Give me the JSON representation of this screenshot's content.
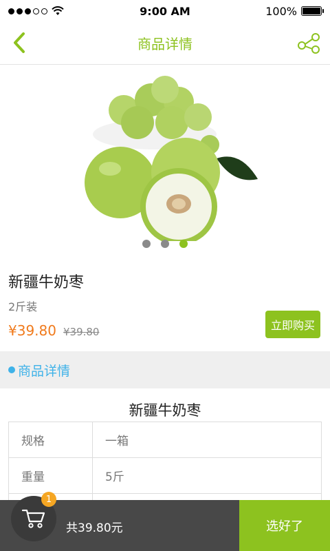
{
  "status_bar": {
    "time": "9:00 AM",
    "battery": "100%"
  },
  "nav": {
    "title": "商品详情",
    "back_icon": "chevron-left-icon",
    "share_icon": "share-icon"
  },
  "carousel": {
    "image": "green-jujube-fruit-image",
    "slide_count": 3,
    "active_index": 2
  },
  "product": {
    "name": "新疆牛奶枣",
    "spec": "2斤装",
    "price": "¥39.80",
    "original_price": "¥39.80",
    "buy_label": "立即购买"
  },
  "section": {
    "title": "商品详情"
  },
  "detail": {
    "title": "新疆牛奶枣",
    "rows": [
      {
        "key": "规格",
        "value": "一箱"
      },
      {
        "key": "重量",
        "value": "5斤"
      }
    ]
  },
  "cart": {
    "count": "1",
    "total_label": "共39.80元",
    "checkout_label": "选好了",
    "cart_icon": "cart-icon"
  },
  "colors": {
    "accent": "#8dc21f",
    "price": "#f07a1c",
    "section": "#3fb2e8",
    "badge": "#f5a623",
    "bottom_bar": "#484848"
  }
}
